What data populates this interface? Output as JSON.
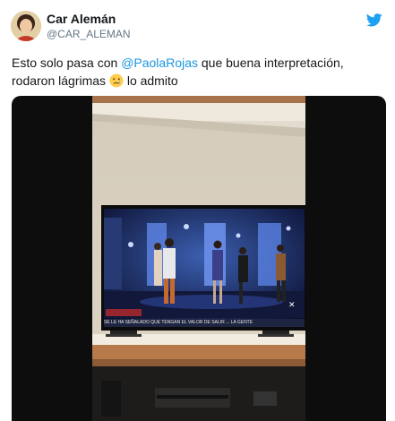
{
  "tweet": {
    "display_name": "Car Alemán",
    "handle": "@CAR_ALEMAN",
    "text_line1_before": "Esto solo pasa con ",
    "mention": "@PaolaRojas",
    "text_line1_after": " que buena interpretación,",
    "text_line2_before": "rodaron lágrimas ",
    "text_line2_after": " lo admito"
  },
  "icons": {
    "platform": "twitter-bird-icon",
    "emoji": "crying-face-emoji"
  },
  "colors": {
    "link": "#1b95e0",
    "brand": "#1da1f2",
    "text": "#14171a",
    "secondary": "#657786"
  },
  "media": {
    "ticker_text": "SE LE HA SEÑALADO QUE TENGAN EL VALOR DE SALIR ... LA GENTE"
  }
}
